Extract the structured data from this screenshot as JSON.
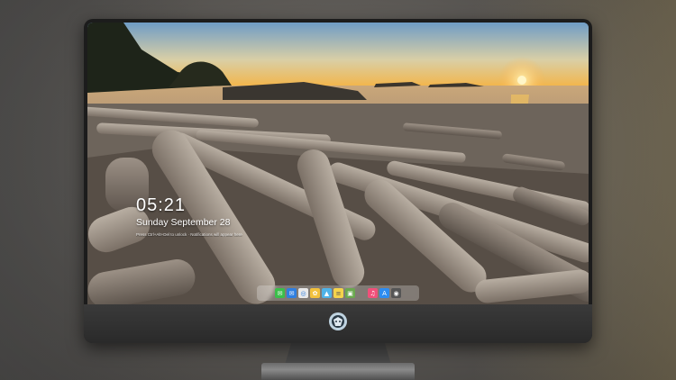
{
  "lockscreen": {
    "time": "05:21",
    "date": "Sunday September  28",
    "notice": "Press Ctrl+Alt+Del to unlock · Notifications will appear here"
  },
  "dock": {
    "icons": [
      {
        "name": "messages-icon",
        "color": "#3bbf4a"
      },
      {
        "name": "mail-icon",
        "color": "#2f7fe0"
      },
      {
        "name": "safari-icon",
        "color": "#e9e9e9"
      },
      {
        "name": "photos-icon",
        "color": "#f2c13c"
      },
      {
        "name": "maps-icon",
        "color": "#4fb3e8"
      },
      {
        "name": "notes-icon",
        "color": "#f5d34b"
      },
      {
        "name": "preview-icon",
        "color": "#6aa84f"
      },
      {
        "name": "music-icon",
        "color": "#f0507a"
      },
      {
        "name": "appstore-icon",
        "color": "#2d8cf0"
      },
      {
        "name": "camera-icon",
        "color": "#555555"
      }
    ]
  },
  "colors": {
    "sun": "#ffd25a",
    "sky_top": "#7fa6c7",
    "bezel": "#1c1c1c"
  }
}
